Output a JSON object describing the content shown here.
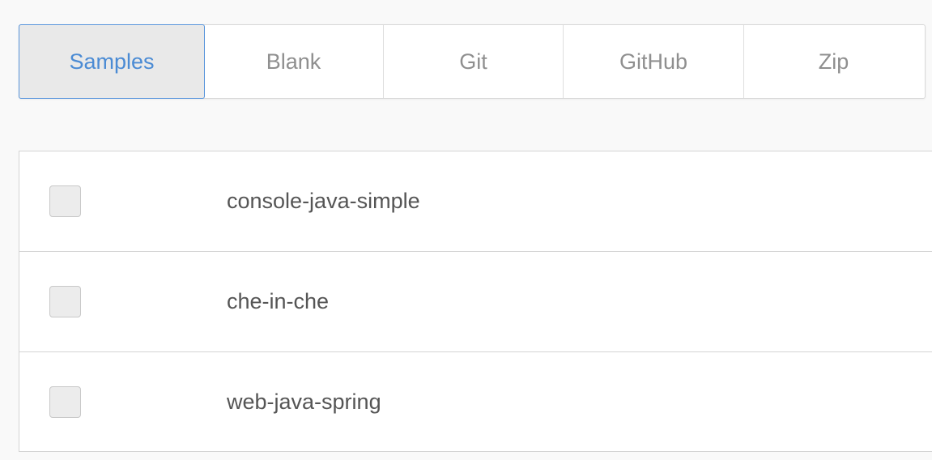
{
  "tabs": [
    {
      "label": "Samples",
      "active": true
    },
    {
      "label": "Blank",
      "active": false
    },
    {
      "label": "Git",
      "active": false
    },
    {
      "label": "GitHub",
      "active": false
    },
    {
      "label": "Zip",
      "active": false
    }
  ],
  "samples": [
    {
      "name": "console-java-simple",
      "checked": false
    },
    {
      "name": "che-in-che",
      "checked": false
    },
    {
      "name": "web-java-spring",
      "checked": false
    }
  ],
  "colors": {
    "accent": "#4b8bd4",
    "active_tab_bg": "#e9e9e9",
    "border": "#d4d4d4"
  }
}
